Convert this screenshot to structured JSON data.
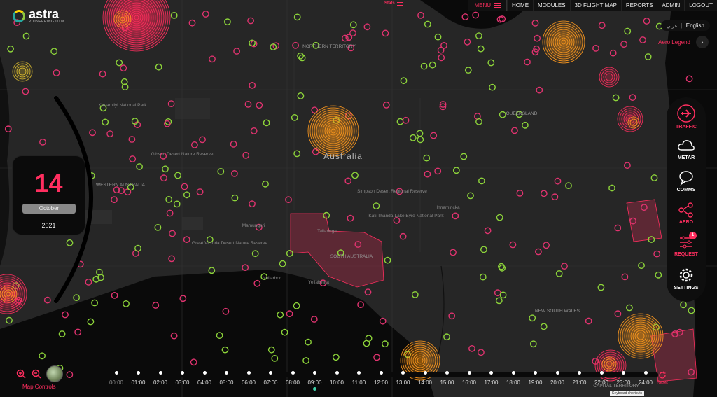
{
  "app": {
    "brand": "astra",
    "tagline": "PIONEERING UTM"
  },
  "stats": {
    "label": "Stats"
  },
  "topnav": {
    "menu_label": "MENU",
    "items": [
      "HOME",
      "MODULES",
      "3D FLIGHT MAP",
      "REPORTS",
      "ADMIN",
      "LOGOUT"
    ]
  },
  "language": {
    "arabic": "عربي",
    "english": "English"
  },
  "aero_legend": {
    "label": "Aero Legend"
  },
  "map": {
    "country_label": "Australia",
    "region_labels": [
      "NORTHERN TERRITORY",
      "QUEENSLAND",
      "WESTERN AUSTRALIA",
      "SOUTH AUSTRALIA",
      "NEW SOUTH WALES",
      "CAPITAL TERRITORY"
    ],
    "place_labels": [
      "Karlamilyi National Park",
      "Gibson Desert Nature Reserve",
      "Great Victoria Desert Nature Reserve",
      "Simpson Desert Regional Reserve",
      "Kati Thanda-Lake Eyre National Park",
      "Mamungari",
      "Nullarbor",
      "Yellabinna",
      "Tallaringa",
      "Innamincka"
    ],
    "colors": {
      "background": "#262626",
      "accent": "#ff2e5f",
      "green_marker": "#8dd43a",
      "pink_marker": "#e0336f",
      "orange_zone": "#ff9a1f"
    }
  },
  "side_panel": {
    "items": [
      {
        "label": "TRAFFIC",
        "icon": "airplane-icon",
        "active": true
      },
      {
        "label": "METAR",
        "icon": "cloud-icon",
        "active": false
      },
      {
        "label": "COMMS",
        "icon": "chat-bubble-icon",
        "active": false
      },
      {
        "label": "AERO",
        "icon": "share-nodes-icon",
        "active": true
      },
      {
        "label": "REQUEST",
        "icon": "sliders-icon",
        "active": true,
        "badge": "1"
      },
      {
        "label": "SETTINGS",
        "icon": "gear-icon",
        "active": false
      }
    ]
  },
  "date": {
    "day": "14",
    "month": "October",
    "year": "2021"
  },
  "map_controls": {
    "label": "Map Controls"
  },
  "timeline": {
    "times": [
      "00:00",
      "01:00",
      "02:00",
      "03:00",
      "04:00",
      "05:00",
      "06:00",
      "07:00",
      "08:00",
      "09:00",
      "10:00",
      "11:00",
      "12:00",
      "13:00",
      "14:00",
      "15:00",
      "16:00",
      "17:00",
      "18:00",
      "19:00",
      "20:00",
      "21:00",
      "22:00",
      "23:00",
      "24:00"
    ],
    "current": "09:00"
  },
  "reset_label": "Reset",
  "keyboard_shortcuts": "Keyboard shortcuts"
}
